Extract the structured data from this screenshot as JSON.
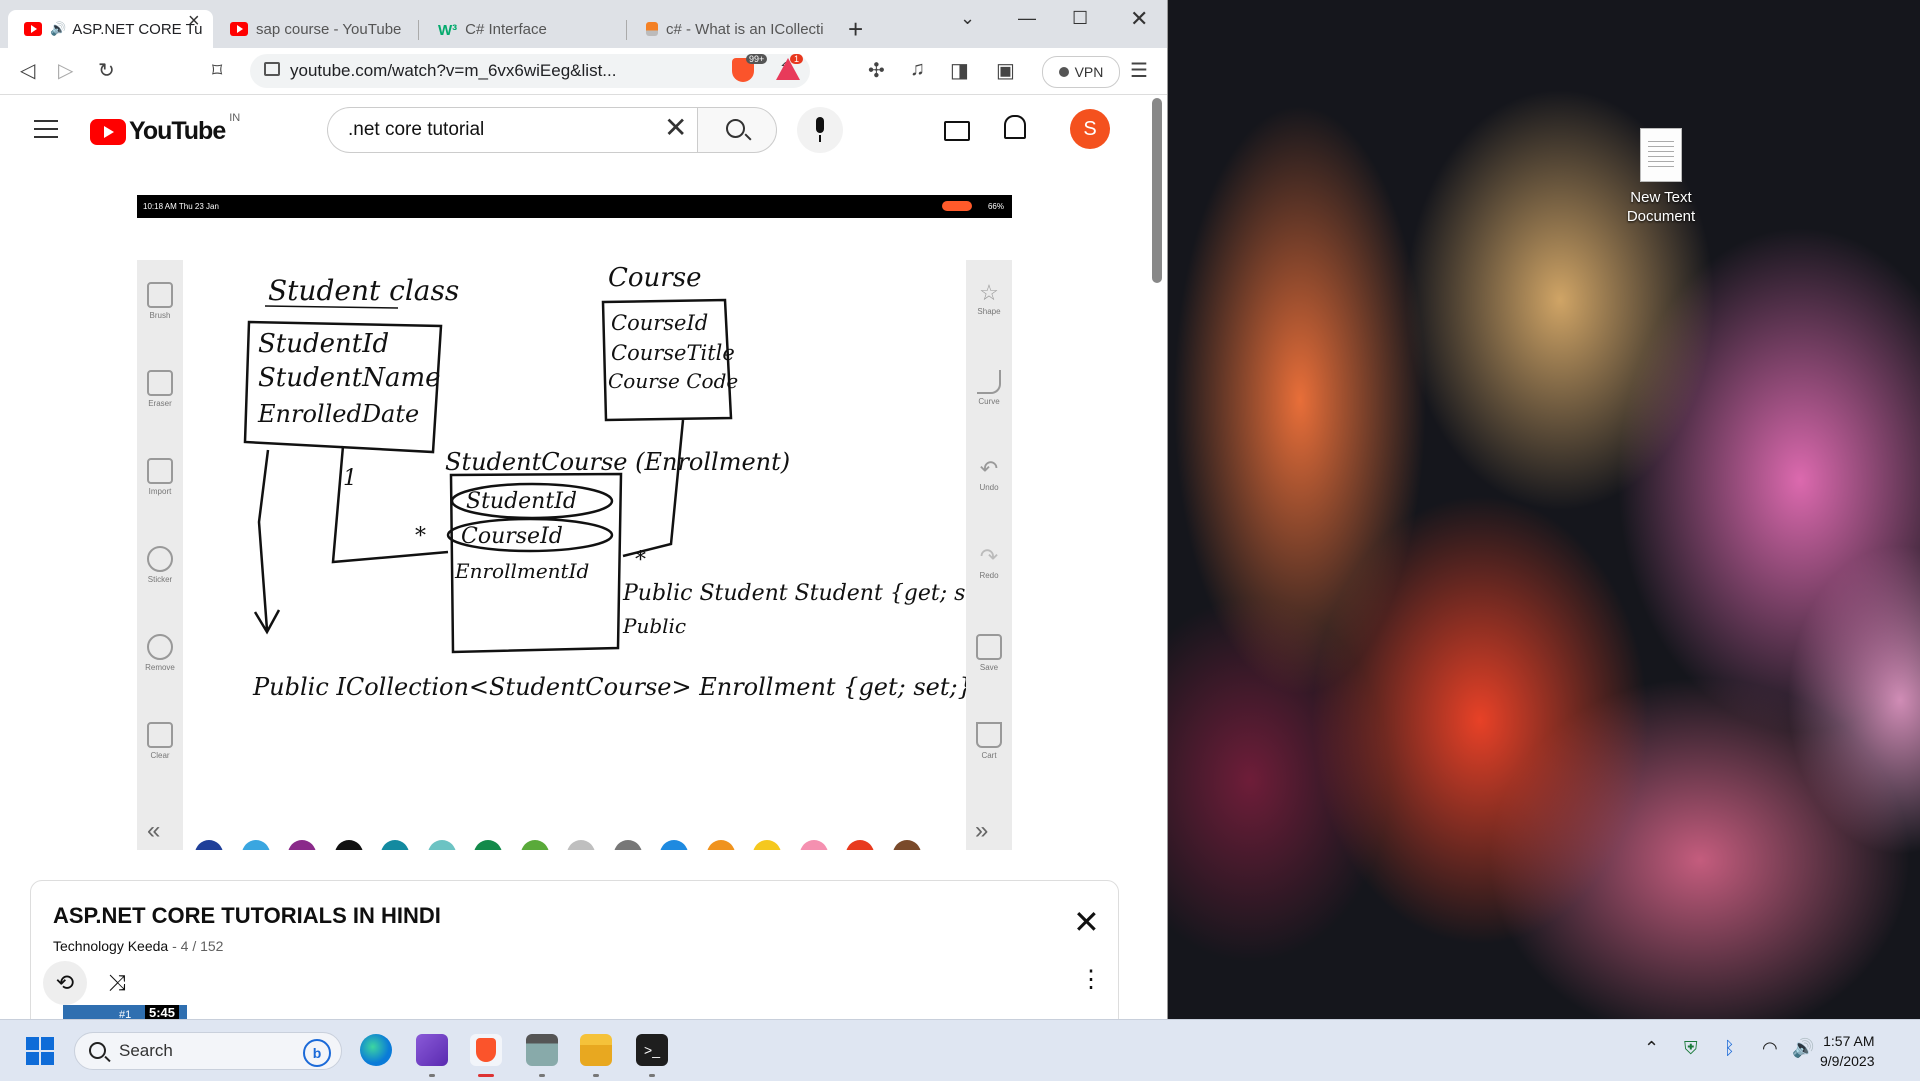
{
  "browser": {
    "tabs": [
      {
        "label": "ASP.NET CORE Tu",
        "active": true,
        "icon": "youtube-icon"
      },
      {
        "label": "sap course - YouTube",
        "active": false,
        "icon": "youtube-icon"
      },
      {
        "label": "C# Interface",
        "active": false,
        "icon": "w3schools-icon"
      },
      {
        "label": "c# - What is an ICollecti",
        "active": false,
        "icon": "stackoverflow-icon"
      }
    ],
    "url": "youtube.com/watch?v=m_6vx6wiEeg&list...",
    "shields_badge": "99+",
    "rewards_badge": "1",
    "vpn_label": "VPN"
  },
  "youtube": {
    "logo_text": "YouTube",
    "country_code": "IN",
    "search_value": ".net core tutorial",
    "avatar_letter": "S"
  },
  "video": {
    "status_time": "10:18 AM  Thu 23 Jan",
    "status_battery": "66%",
    "left_tools": [
      "Brush",
      "Eraser",
      "Import",
      "Sticker",
      "Remove",
      "Clear"
    ],
    "right_tools": [
      "Shape",
      "Curve",
      "Undo",
      "Redo",
      "Save",
      "Cart"
    ],
    "board_text": {
      "student_class": "Student class",
      "student_fields": [
        "StudentId",
        "StudentName",
        "EnrolledDate"
      ],
      "course": "Course",
      "course_fields": [
        "CourseId",
        "CourseTitle",
        "Course Code"
      ],
      "one": "1",
      "many": "*",
      "student_course": "StudentCourse (Enrollment)",
      "sc_fields": [
        "StudentId",
        "CourseId",
        "EnrollmentId"
      ],
      "public_student": "Public Student Student {get; set;}",
      "public": "Public",
      "bottom_line": "Public ICollection<StudentCourse> Enrollment {get; set;}"
    },
    "palette": [
      "#1f3f99",
      "#3aa6e0",
      "#8a2a8a",
      "#111111",
      "#138aa0",
      "#6cc3c3",
      "#138a4a",
      "#5aaa3a",
      "#bfbfbf",
      "#777777",
      "#1e8ae0",
      "#f0931e",
      "#f5c81e",
      "#f590b0",
      "#e83a1e",
      "#7a4a2a"
    ]
  },
  "playlist": {
    "title": "ASP.NET CORE TUTORIALS IN HINDI",
    "channel": "Technology Keeda",
    "position": "- 4 / 152",
    "thumb_rank": "#1",
    "thumb_duration": "5:45"
  },
  "desktop": {
    "icon_label_1": "New Text",
    "icon_label_2": "Document"
  },
  "taskbar": {
    "search_placeholder": "Search",
    "time": "1:57 AM",
    "date": "9/9/2023"
  }
}
